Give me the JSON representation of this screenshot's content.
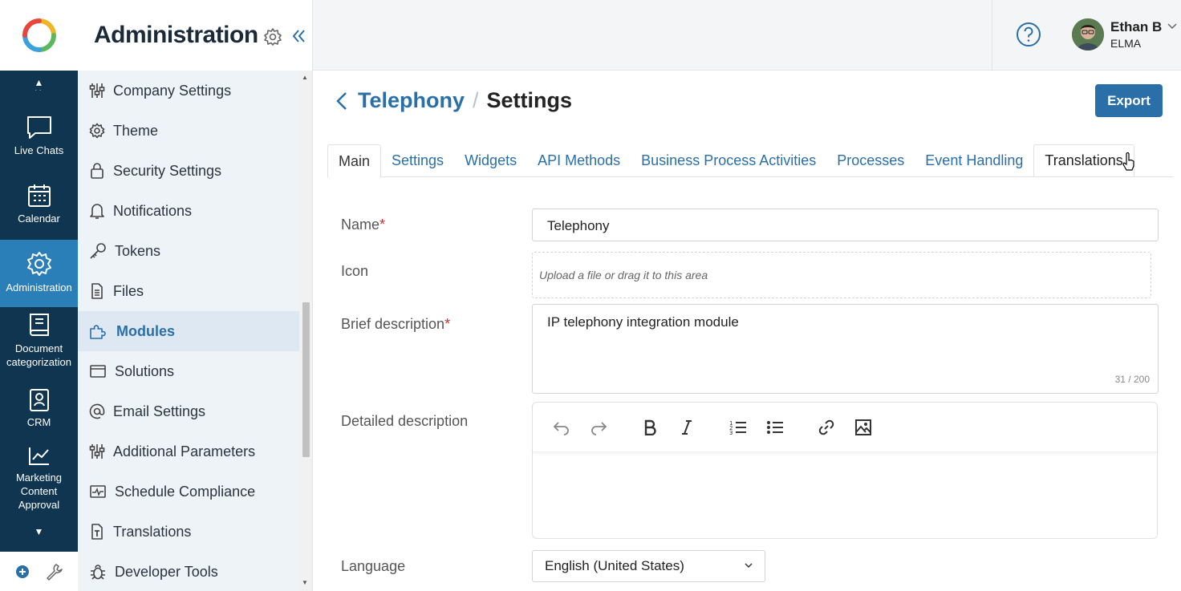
{
  "rail": {
    "items": [
      {
        "label": "Live Chats",
        "icon": "chat-icon"
      },
      {
        "label": "Calendar",
        "icon": "calendar-icon"
      },
      {
        "label": "Administration",
        "icon": "gear-icon"
      },
      {
        "label": "Document categorization",
        "icon": "book-icon"
      },
      {
        "label": "CRM",
        "icon": "contact-card-icon"
      },
      {
        "label": "Marketing Content Approval",
        "icon": "chart-icon"
      }
    ],
    "active_color": "#2a7fb8",
    "background": "#0f3550"
  },
  "admin": {
    "title": "Administration",
    "items": [
      {
        "label": "Company Settings"
      },
      {
        "label": "Theme"
      },
      {
        "label": "Security Settings"
      },
      {
        "label": "Notifications"
      },
      {
        "label": "Tokens"
      },
      {
        "label": "Files"
      },
      {
        "label": "Modules"
      },
      {
        "label": "Solutions"
      },
      {
        "label": "Email Settings"
      },
      {
        "label": "Additional Parameters"
      },
      {
        "label": "Schedule Compliance"
      },
      {
        "label": "Translations"
      },
      {
        "label": "Developer Tools"
      }
    ],
    "active_item": "Modules"
  },
  "header": {
    "user_name": "Ethan B",
    "user_org": "ELMA"
  },
  "page": {
    "breadcrumb_link": "Telephony",
    "breadcrumb_sep": "/",
    "breadcrumb_current": "Settings",
    "export_label": "Export",
    "tabs": [
      {
        "label": "Main"
      },
      {
        "label": "Settings"
      },
      {
        "label": "Widgets"
      },
      {
        "label": "API Methods"
      },
      {
        "label": "Business Process Activities"
      },
      {
        "label": "Processes"
      },
      {
        "label": "Event Handling"
      },
      {
        "label": "Translations"
      }
    ],
    "active_tab": "Main"
  },
  "form": {
    "name_label": "Name",
    "name_value": "Telephony",
    "icon_label": "Icon",
    "upload_hint": "Upload a file or drag it to this area",
    "brief_label": "Brief description",
    "brief_value": "IP telephony integration module",
    "brief_counter": "31 / 200",
    "detailed_label": "Detailed description",
    "language_label": "Language",
    "language_value": "English (United States)",
    "required_mark": "*"
  },
  "accent": "#2a6fa8"
}
